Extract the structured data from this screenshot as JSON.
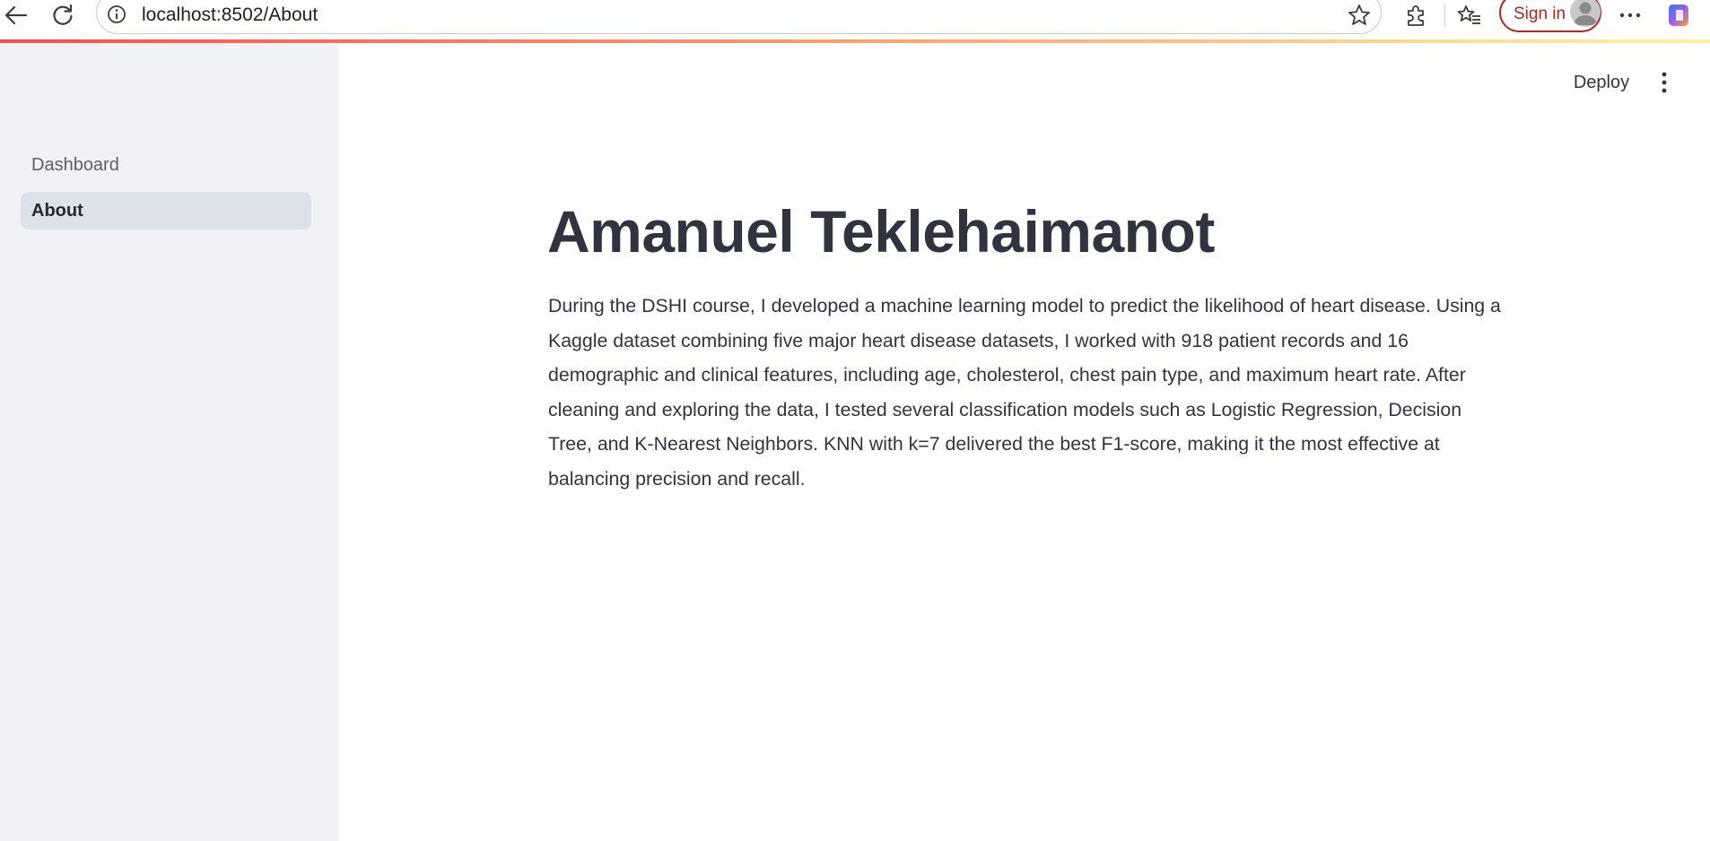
{
  "browser": {
    "url": "localhost:8502/About",
    "sign_in_label": "Sign in",
    "icons": [
      "back-arrow-icon",
      "refresh-icon",
      "info-icon",
      "star-icon",
      "extensions-icon",
      "favorites-icon",
      "profile-icon",
      "more-horizontal-icon",
      "copilot-icon"
    ]
  },
  "sidebar": {
    "items": [
      {
        "label": "Dashboard",
        "active": false
      },
      {
        "label": "About",
        "active": true
      }
    ]
  },
  "header": {
    "deploy_label": "Deploy",
    "menu_icon": "more-vertical-icon"
  },
  "main": {
    "title": "Amanuel Teklehaimanot",
    "paragraph": "During the DSHI course, I developed a machine learning model to predict the likelihood of heart disease. Using a Kaggle dataset combining five major heart disease datasets, I worked with 918 patient records and 16 demographic and clinical features, including age, cholesterol, chest pain type, and maximum heart rate. After cleaning and exploring the data, I tested several classification models such as Logistic Regression, Decision Tree, and K-Nearest Neighbors. KNN with k=7 delivered the best F1-score, making it the most effective at balancing precision and recall."
  },
  "colors": {
    "sidebar_bg": "#f0f2f6",
    "active_item_bg": "#dde1ea",
    "text": "#31333f",
    "sign_in_accent": "#b3261e",
    "accent_gradient_start": "#ff4b4b"
  }
}
